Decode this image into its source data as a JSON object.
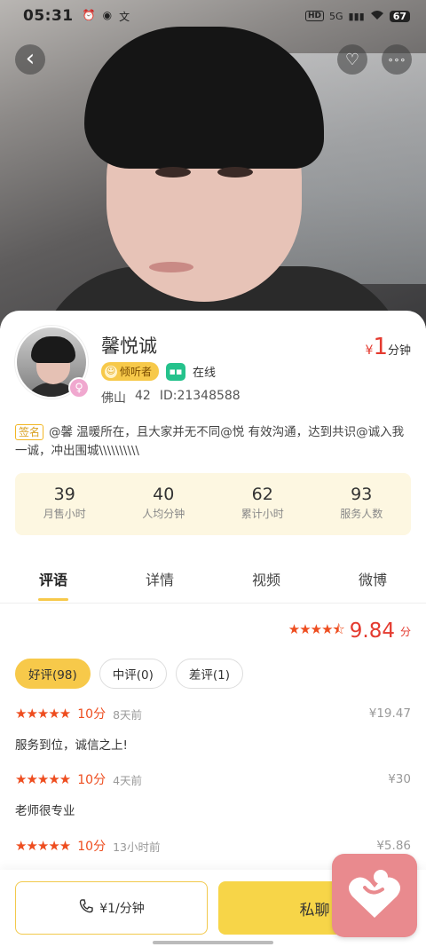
{
  "status_bar": {
    "time": "05:31",
    "app_icons": [
      "alarm-icon",
      "app-icon",
      "translate-icon"
    ],
    "network": "5G",
    "hd": "HD",
    "battery": "67"
  },
  "header": {
    "back_label": "‹",
    "favorite_label": "♡",
    "more_label": "∘∘∘"
  },
  "profile": {
    "name": "馨悦诚",
    "price_symbol": "¥",
    "price_value": "1",
    "price_unit": "分钟",
    "tag_listener": "倾听者",
    "online_status": "在线",
    "city": "佛山",
    "age": "42",
    "id_text": "ID:21348588",
    "sign_label": "签名",
    "signature": "@馨  温暖所在，且大家并无不同@悦  有效沟通，达到共识@诚入我一诚，冲出围城\\\\\\\\\\\\\\\\\\\\"
  },
  "stats": [
    {
      "value": "39",
      "label": "月售小时"
    },
    {
      "value": "40",
      "label": "人均分钟"
    },
    {
      "value": "62",
      "label": "累计小时"
    },
    {
      "value": "93",
      "label": "服务人数"
    }
  ],
  "tabs": [
    {
      "label": "评语",
      "active": true
    },
    {
      "label": "详情",
      "active": false
    },
    {
      "label": "视频",
      "active": false
    },
    {
      "label": "微博",
      "active": false
    }
  ],
  "rating": {
    "stars": "★★★★⯪",
    "score": "9.84",
    "unit": "分",
    "stars_value": 4.5
  },
  "filters": [
    {
      "label": "好评(98)",
      "selected": true
    },
    {
      "label": "中评(0)",
      "selected": false
    },
    {
      "label": "差评(1)",
      "selected": false
    }
  ],
  "reviews": [
    {
      "stars": "★★★★★",
      "points": "10分",
      "time": "8天前",
      "amount": "¥19.47",
      "text": "服务到位，诚信之上!"
    },
    {
      "stars": "★★★★★",
      "points": "10分",
      "time": "4天前",
      "amount": "¥30",
      "text": "老师很专业"
    },
    {
      "stars": "★★★★★",
      "points": "10分",
      "time": "13小时前",
      "amount": "¥5.86",
      "text": ""
    }
  ],
  "bottom": {
    "call_label": "¥1/分钟",
    "chat_label": "私聊"
  },
  "colors": {
    "accent": "#f7c94a",
    "price_red": "#e43a2f",
    "star_orange": "#ee4d1f",
    "online_green": "#25c28c"
  }
}
